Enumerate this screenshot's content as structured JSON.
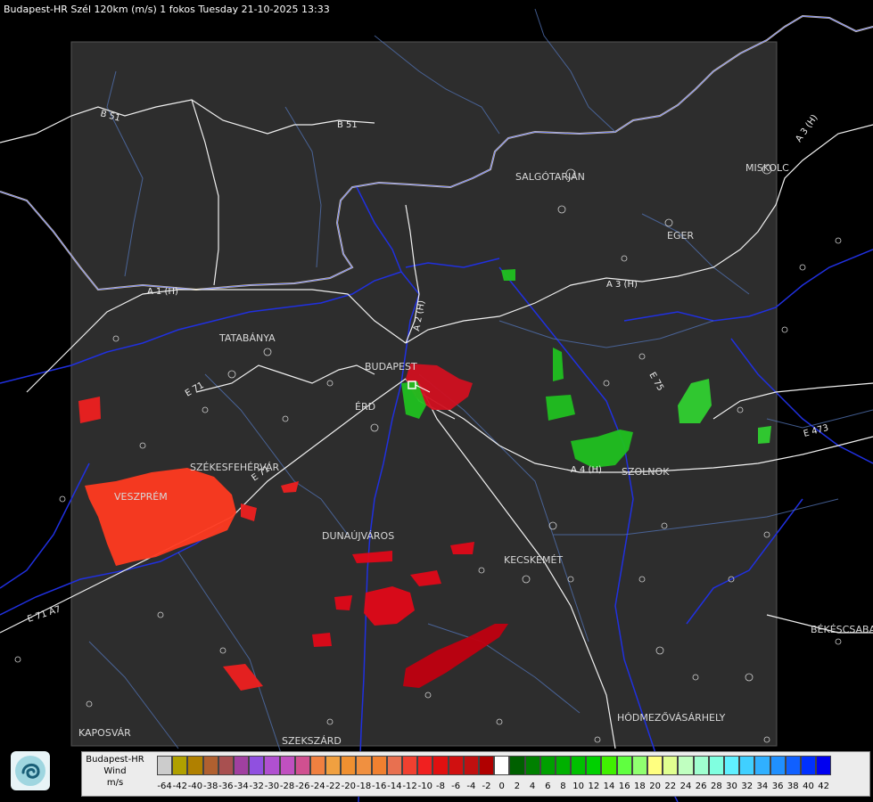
{
  "title": "Budapest-HR Szél 120km (m/s) 1 fokos Tuesday 21-10-2025 13:33",
  "cities": [
    {
      "id": "salgotarjan",
      "name": "SALGÓTARJÁN"
    },
    {
      "id": "miskolc",
      "name": "MISKOLC"
    },
    {
      "id": "eger",
      "name": "EGER"
    },
    {
      "id": "tatabanya",
      "name": "TATABÁNYA"
    },
    {
      "id": "budapest",
      "name": "BUDAPEST"
    },
    {
      "id": "erd",
      "name": "ÉRD"
    },
    {
      "id": "szekesfehervar",
      "name": "SZÉKESFEHÉRVÁR"
    },
    {
      "id": "veszprem",
      "name": "VESZPRÉM"
    },
    {
      "id": "szolnok",
      "name": "SZOLNOK"
    },
    {
      "id": "dunaujvaros",
      "name": "DUNAÚJVÁROS"
    },
    {
      "id": "kecskemet",
      "name": "KECSKEMÉT"
    },
    {
      "id": "bekescsaba",
      "name": "BÉKÉSCSABA"
    },
    {
      "id": "hodmezovasarhely",
      "name": "HÓDMEZŐVÁSÁRHELY"
    },
    {
      "id": "kaposvar",
      "name": "KAPOSVÁR"
    },
    {
      "id": "szekszard",
      "name": "SZEKSZÁRD"
    }
  ],
  "roads": [
    {
      "id": "b51-left",
      "name": "B 51"
    },
    {
      "id": "b51-top",
      "name": "B 51"
    },
    {
      "id": "a3-north",
      "name": "A 3 (H)"
    },
    {
      "id": "a3-mid",
      "name": "A 3 (H)"
    },
    {
      "id": "a1",
      "name": "A 1 (H)"
    },
    {
      "id": "a2",
      "name": "A 2 (H)"
    },
    {
      "id": "a4",
      "name": "A 4 (H)"
    },
    {
      "id": "e71",
      "name": "E 71"
    },
    {
      "id": "e71-sw",
      "name": "E 71 A7"
    },
    {
      "id": "e71-ne",
      "name": "E 71"
    },
    {
      "id": "e75",
      "name": "E 75"
    },
    {
      "id": "e473",
      "name": "E 473"
    }
  ],
  "legend": {
    "line1": "Budapest-HR",
    "line2": "Wind",
    "line3": "m/s",
    "values": [
      "-64",
      "-42",
      "-40",
      "-38",
      "-36",
      "-34",
      "-32",
      "-30",
      "-28",
      "-26",
      "-24",
      "-22",
      "-20",
      "-18",
      "-16",
      "-14",
      "-12",
      "-10",
      "-8",
      "-6",
      "-4",
      "-2",
      "0",
      "2",
      "4",
      "6",
      "8",
      "10",
      "12",
      "14",
      "16",
      "18",
      "20",
      "22",
      "24",
      "26",
      "28",
      "30",
      "32",
      "34",
      "36",
      "38",
      "40",
      "42"
    ],
    "colors": [
      "#cccccc",
      "#b0a000",
      "#b08000",
      "#b06030",
      "#a85050",
      "#a040a0",
      "#9050e0",
      "#b050d0",
      "#c050c0",
      "#d05090",
      "#f08040",
      "#f0a040",
      "#f09030",
      "#f09040",
      "#f08030",
      "#e87050",
      "#f04030",
      "#f02020",
      "#e01010",
      "#d01010",
      "#c01010",
      "#b00000",
      "#ffffff",
      "#006000",
      "#008000",
      "#00a000",
      "#00b000",
      "#00c000",
      "#00d000",
      "#40f000",
      "#60ff40",
      "#90ff70",
      "#ffff80",
      "#e0ff90",
      "#c0ffc0",
      "#a0ffd0",
      "#80ffe0",
      "#60f0ff",
      "#40d0ff",
      "#30b0ff",
      "#2090ff",
      "#1060ff",
      "#0030ff",
      "#0000f0"
    ]
  },
  "echoes": [
    {
      "id": "veszprem-echo",
      "color": "#ff3a20"
    },
    {
      "id": "west-echo",
      "color": "#ee2020"
    },
    {
      "id": "dunaujvaros-echo",
      "color": "#e00818"
    },
    {
      "id": "kecskemet-echo",
      "color": "#c00010"
    },
    {
      "id": "szolnok-echo",
      "color": "#20c020"
    },
    {
      "id": "east-echo",
      "color": "#30d030"
    },
    {
      "id": "budapest-echo",
      "color": "#d01020"
    }
  ]
}
